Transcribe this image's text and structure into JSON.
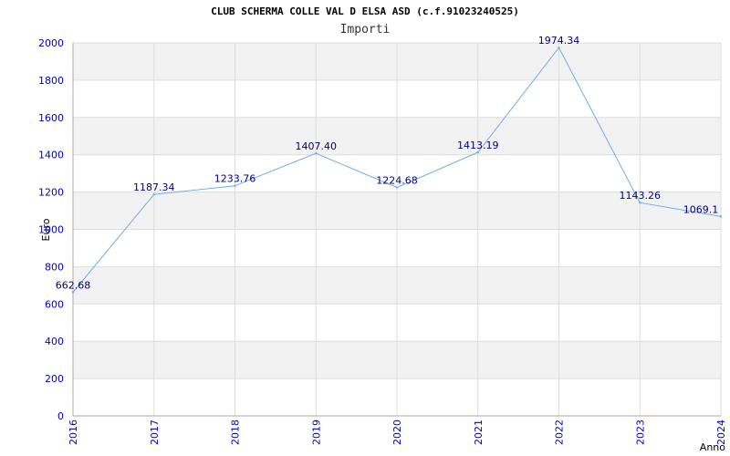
{
  "chart_data": {
    "type": "line",
    "title": "CLUB SCHERMA COLLE VAL D ELSA ASD (c.f.91023240525)",
    "subtitle": "Importi",
    "xlabel": "Anno",
    "ylabel": "Euro",
    "x": [
      "2016",
      "2017",
      "2018",
      "2019",
      "2020",
      "2021",
      "2022",
      "2023",
      "2024"
    ],
    "series": [
      {
        "values": [
          662.68,
          1187.34,
          1233.76,
          1407.4,
          1224.68,
          1413.19,
          1974.34,
          1143.26,
          1069.1
        ],
        "labels": [
          "662.68",
          "1187.34",
          "1233.76",
          "1407.40",
          "1224.68",
          "1413.19",
          "1974.34",
          "1143.26",
          "1069.1"
        ]
      }
    ],
    "yticks": [
      "0",
      "200",
      "400",
      "600",
      "800",
      "1000",
      "1200",
      "1400",
      "1600",
      "1800",
      "2000"
    ],
    "ylim": [
      0,
      2000
    ],
    "grid": true,
    "colors": {
      "line": "#6aaee8",
      "tick_text": "#0000cc",
      "data_label": "#000080",
      "band": "#f2f2f2",
      "gridline": "#dddddd"
    }
  }
}
